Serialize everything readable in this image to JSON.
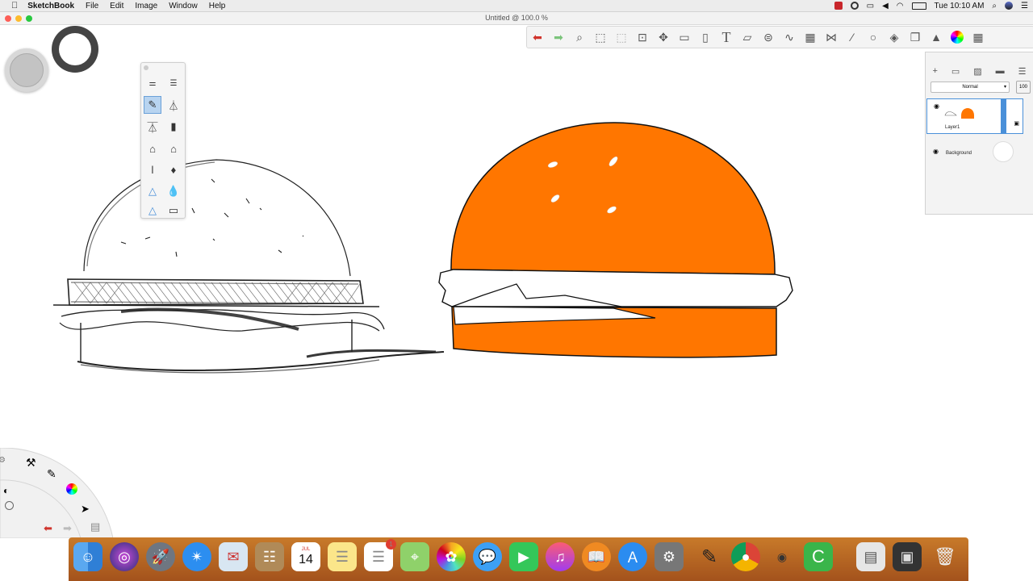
{
  "menubar": {
    "app_name": "SketchBook",
    "items": [
      "File",
      "Edit",
      "Image",
      "Window",
      "Help"
    ],
    "clock": "Tue 10:10 AM"
  },
  "window": {
    "title": "Untitled @ 100.0 %"
  },
  "layers_panel": {
    "blend_mode": "Normal",
    "opacity": "100",
    "layers": [
      {
        "name": "Layer1",
        "visible": true
      },
      {
        "name": "Background",
        "visible": true
      }
    ]
  },
  "toolbar": {
    "tools": [
      "undo-icon",
      "redo-icon",
      "zoom-icon",
      "select-rect-icon",
      "select-lasso-icon",
      "crop-icon",
      "transform-icon",
      "distort-icon",
      "fill-icon",
      "text-icon",
      "ruler-icon",
      "ellipse-guide-icon",
      "curve-icon",
      "perspective-icon",
      "symmetry-icon",
      "stroke-icon",
      "ellipse-icon",
      "shape-icon",
      "copy-icon",
      "brush-library-icon",
      "color-wheel-icon",
      "grid-icon"
    ]
  },
  "dock": {
    "calendar_month": "JUL",
    "calendar_day": "14",
    "reminders_badge": "1"
  },
  "colors": {
    "bun_orange": "#ff7600",
    "accent_blue": "#4a90d9"
  }
}
